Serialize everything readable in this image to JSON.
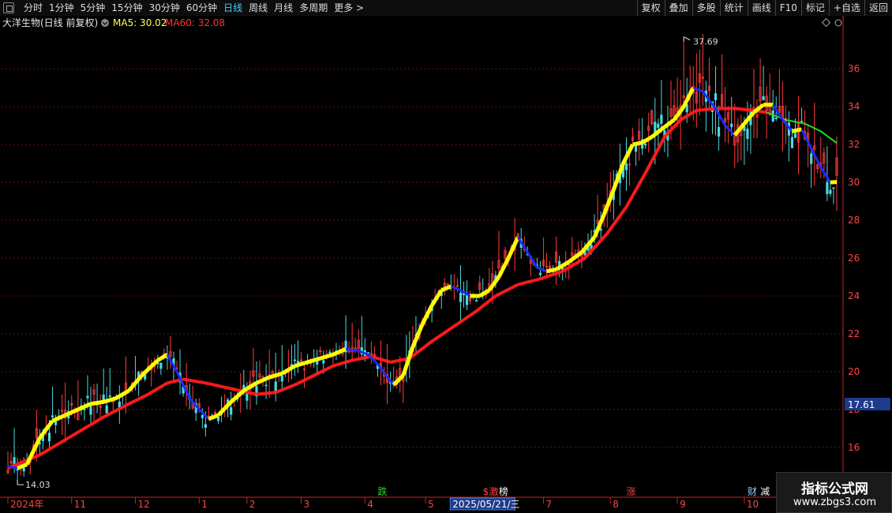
{
  "toolbar": {
    "timeframes": [
      "分时",
      "1分钟",
      "5分钟",
      "15分钟",
      "30分钟",
      "60分钟",
      "日线",
      "周线",
      "月线",
      "多周期",
      "更多 >"
    ],
    "active_index": 6,
    "right_buttons": [
      "复权",
      "叠加",
      "多股",
      "统计",
      "画线",
      "F10",
      "标记",
      "+自选",
      "返回"
    ]
  },
  "header": {
    "stock_title": "大洋生物(日线 前复权)",
    "ma5_label": "MA5: 30.02",
    "ma60_label": "MA60: 32.08"
  },
  "watermark": {
    "line1": "指标公式网",
    "line2": "www.zbgs3.com"
  },
  "colors": {
    "up": "#ff3b3b",
    "down": "#4bd8e0",
    "rising": "#ffff00",
    "falling": "#1a2bff",
    "ma60_up": "#ff1a1a",
    "ma60_down": "#22dd22",
    "axis": "#cc2222",
    "grid": "#661111",
    "price_axis_text": "#ff4444",
    "last_price_bg": "#1e3a8a"
  },
  "chart_data": {
    "type": "candlestick",
    "ylim": [
      14.2,
      38.3
    ],
    "y_ticks": [
      16,
      18,
      20,
      22,
      24,
      26,
      28,
      30,
      32,
      34,
      36
    ],
    "high_annotation": "37.69",
    "low_annotation": "14.03",
    "last_price_label": "17.61",
    "x_labels": [
      {
        "i": 0,
        "text": "2024年"
      },
      {
        "i": 20,
        "text": "11"
      },
      {
        "i": 40,
        "text": "12"
      },
      {
        "i": 60,
        "text": "1"
      },
      {
        "i": 75,
        "text": "2"
      },
      {
        "i": 92,
        "text": "3"
      },
      {
        "i": 112,
        "text": "4"
      },
      {
        "i": 131,
        "text": "5"
      },
      {
        "i": 150,
        "text": "6"
      },
      {
        "i": 168,
        "text": "7"
      },
      {
        "i": 189,
        "text": "8"
      },
      {
        "i": 210,
        "text": "9"
      },
      {
        "i": 231,
        "text": "10"
      }
    ],
    "selected_date": "2025/05/21/三",
    "event_markers": [
      {
        "i": 116,
        "text": "跌",
        "color": "#22dd22"
      },
      {
        "i": 149,
        "text": "$激",
        "color": "#ff4444"
      },
      {
        "i": 154,
        "text": "榜",
        "color": "#ffffff"
      },
      {
        "i": 194,
        "text": "涨",
        "color": "#ff4444"
      },
      {
        "i": 232,
        "text": "财",
        "color": "#8ad0ff"
      },
      {
        "i": 236,
        "text": "减",
        "color": "#ffffff"
      }
    ],
    "ma5_knots": [
      [
        0,
        15.0
      ],
      [
        3,
        14.9
      ],
      [
        6,
        15.1
      ],
      [
        10,
        16.5
      ],
      [
        14,
        17.4
      ],
      [
        18,
        17.7
      ],
      [
        22,
        18.0
      ],
      [
        26,
        18.3
      ],
      [
        30,
        18.4
      ],
      [
        34,
        18.6
      ],
      [
        38,
        19.0
      ],
      [
        42,
        19.8
      ],
      [
        47,
        20.6
      ],
      [
        50,
        20.9
      ],
      [
        53,
        20.0
      ],
      [
        57,
        18.6
      ],
      [
        60,
        18.0
      ],
      [
        63,
        17.5
      ],
      [
        66,
        17.7
      ],
      [
        70,
        18.4
      ],
      [
        74,
        19.0
      ],
      [
        78,
        19.4
      ],
      [
        82,
        19.7
      ],
      [
        86,
        19.9
      ],
      [
        90,
        20.3
      ],
      [
        94,
        20.5
      ],
      [
        98,
        20.7
      ],
      [
        102,
        20.9
      ],
      [
        106,
        21.2
      ],
      [
        110,
        21.1
      ],
      [
        113,
        20.9
      ],
      [
        116,
        20.4
      ],
      [
        119,
        19.7
      ],
      [
        121,
        19.3
      ],
      [
        124,
        19.8
      ],
      [
        127,
        21.3
      ],
      [
        130,
        22.5
      ],
      [
        133,
        23.5
      ],
      [
        136,
        24.3
      ],
      [
        139,
        24.5
      ],
      [
        142,
        24.3
      ],
      [
        145,
        24.0
      ],
      [
        148,
        24.0
      ],
      [
        151,
        24.3
      ],
      [
        154,
        25.0
      ],
      [
        157,
        26.0
      ],
      [
        160,
        27.1
      ],
      [
        163,
        26.3
      ],
      [
        166,
        25.5
      ],
      [
        169,
        25.3
      ],
      [
        172,
        25.4
      ],
      [
        176,
        25.8
      ],
      [
        180,
        26.3
      ],
      [
        184,
        27.1
      ],
      [
        187,
        28.3
      ],
      [
        190,
        29.6
      ],
      [
        193,
        31.0
      ],
      [
        196,
        32.0
      ],
      [
        199,
        32.1
      ],
      [
        202,
        32.4
      ],
      [
        205,
        32.8
      ],
      [
        209,
        33.3
      ],
      [
        212,
        34.0
      ],
      [
        215,
        35.0
      ],
      [
        218,
        34.8
      ],
      [
        222,
        33.9
      ],
      [
        225,
        33.0
      ],
      [
        228,
        32.5
      ],
      [
        231,
        33.1
      ],
      [
        234,
        33.7
      ],
      [
        237,
        34.1
      ],
      [
        240,
        34.1
      ],
      [
        243,
        33.3
      ],
      [
        246,
        32.7
      ],
      [
        249,
        32.8
      ],
      [
        252,
        31.8
      ],
      [
        255,
        30.8
      ],
      [
        258,
        30.0
      ],
      [
        260,
        30.02
      ]
    ],
    "ma60_knots": [
      [
        0,
        14.9
      ],
      [
        10,
        15.6
      ],
      [
        20,
        16.6
      ],
      [
        30,
        17.6
      ],
      [
        38,
        18.3
      ],
      [
        44,
        18.8
      ],
      [
        50,
        19.4
      ],
      [
        55,
        19.6
      ],
      [
        62,
        19.4
      ],
      [
        70,
        19.1
      ],
      [
        78,
        18.8
      ],
      [
        84,
        18.9
      ],
      [
        90,
        19.3
      ],
      [
        96,
        19.8
      ],
      [
        102,
        20.3
      ],
      [
        108,
        20.6
      ],
      [
        114,
        20.8
      ],
      [
        120,
        20.5
      ],
      [
        126,
        20.7
      ],
      [
        133,
        21.6
      ],
      [
        140,
        22.4
      ],
      [
        147,
        23.2
      ],
      [
        153,
        24.0
      ],
      [
        160,
        24.6
      ],
      [
        167,
        24.9
      ],
      [
        174,
        25.3
      ],
      [
        181,
        26.0
      ],
      [
        188,
        27.3
      ],
      [
        194,
        28.7
      ],
      [
        200,
        30.5
      ],
      [
        206,
        32.4
      ],
      [
        211,
        33.3
      ],
      [
        216,
        33.8
      ],
      [
        222,
        33.9
      ],
      [
        228,
        33.9
      ],
      [
        234,
        33.8
      ],
      [
        238,
        33.7
      ],
      [
        244,
        33.3
      ],
      [
        250,
        33.1
      ],
      [
        255,
        32.7
      ],
      [
        260,
        32.08
      ]
    ],
    "ma60_turns_down_at": 238
  }
}
